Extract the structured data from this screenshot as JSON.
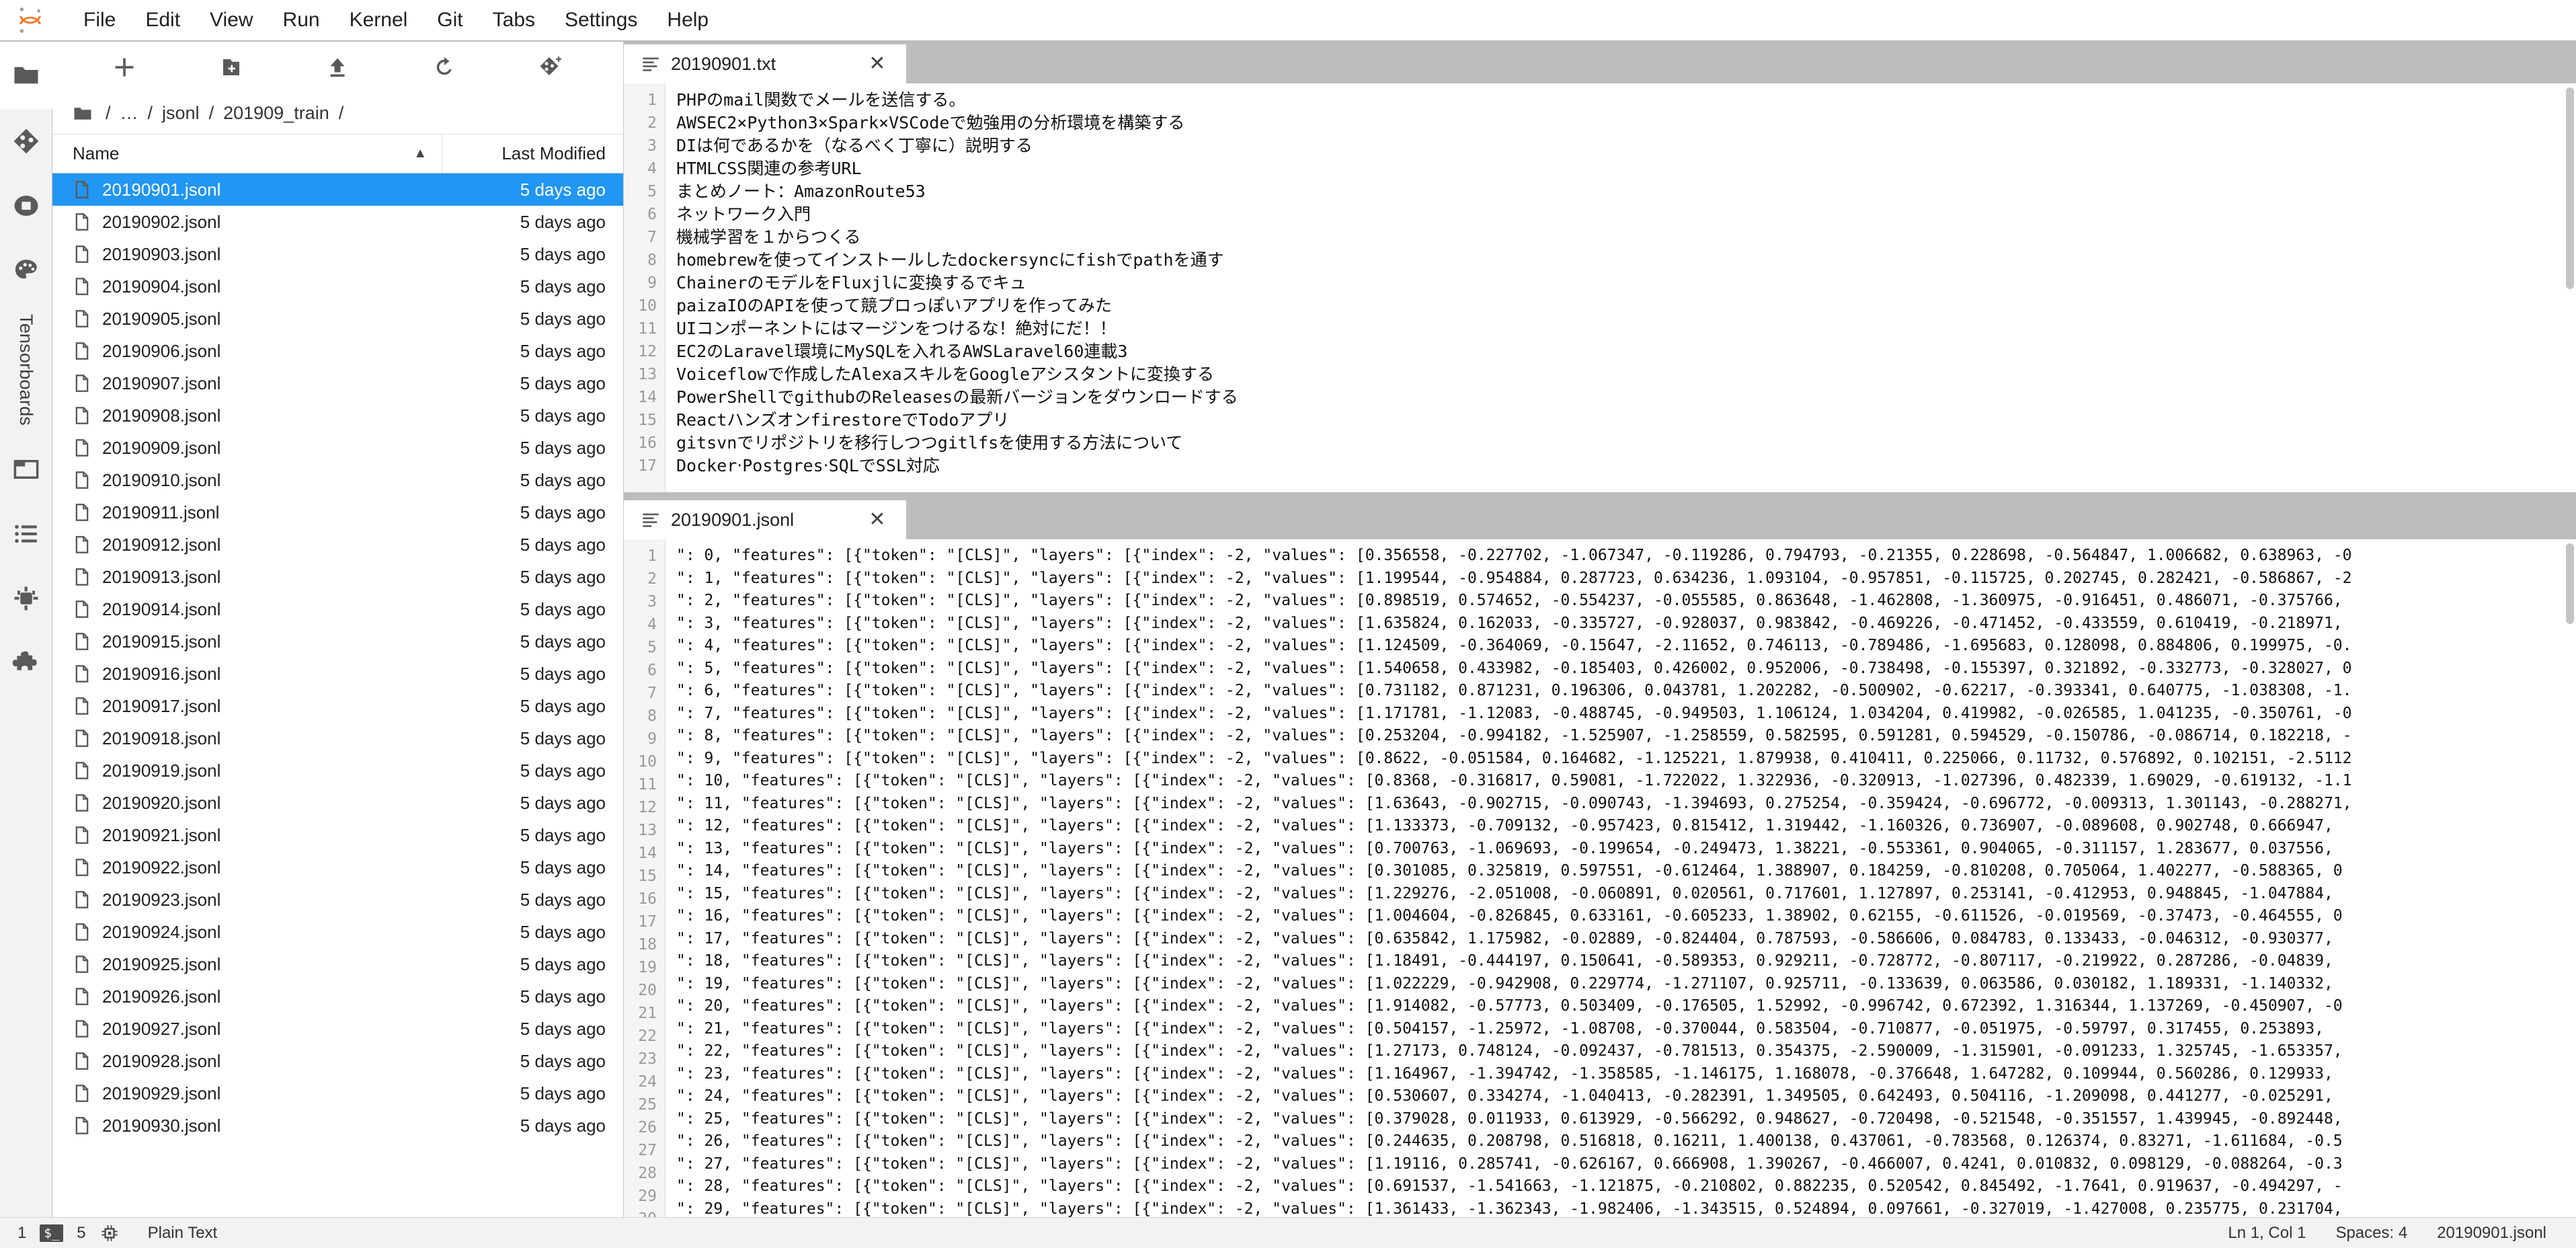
{
  "app": {
    "logo_icon": "jupyter-logo",
    "menu": [
      "File",
      "Edit",
      "View",
      "Run",
      "Kernel",
      "Git",
      "Tabs",
      "Settings",
      "Help"
    ]
  },
  "activitybar": {
    "items": [
      {
        "icon": "folder-icon",
        "name": "file-browser",
        "active": true
      },
      {
        "icon": "git-icon",
        "name": "git",
        "active": false
      },
      {
        "icon": "running-terminals-icon",
        "name": "running",
        "active": false
      },
      {
        "icon": "palette-icon",
        "name": "property-inspector",
        "active": false
      },
      {
        "icon": "tensorboard-label",
        "name": "tensorboards",
        "label": "Tensorboards",
        "active": false
      },
      {
        "icon": "open-tabs-icon",
        "name": "open-tabs",
        "active": false
      },
      {
        "icon": "toc-icon",
        "name": "table-of-contents",
        "active": false
      },
      {
        "icon": "extensions-icon",
        "name": "extension-manager",
        "active": false
      },
      {
        "icon": "puzzle-icon",
        "name": "plugins",
        "active": false
      }
    ]
  },
  "filebrowser": {
    "toolbar": [
      {
        "name": "new-launcher-button",
        "icon": "plus-icon"
      },
      {
        "name": "new-folder-button",
        "icon": "new-folder-icon"
      },
      {
        "name": "upload-button",
        "icon": "upload-icon"
      },
      {
        "name": "refresh-button",
        "icon": "refresh-icon"
      },
      {
        "name": "new-git-clone-button",
        "icon": "git-plus-icon"
      }
    ],
    "breadcrumb": [
      "/",
      "…",
      "/",
      "jsonl",
      "/",
      "201909_train",
      "/"
    ],
    "columns": {
      "name": "Name",
      "modified": "Last Modified"
    },
    "sort_indicator": "▲",
    "files": [
      {
        "name": "20190901.jsonl",
        "modified": "5 days ago",
        "selected": true
      },
      {
        "name": "20190902.jsonl",
        "modified": "5 days ago",
        "selected": false
      },
      {
        "name": "20190903.jsonl",
        "modified": "5 days ago",
        "selected": false
      },
      {
        "name": "20190904.jsonl",
        "modified": "5 days ago",
        "selected": false
      },
      {
        "name": "20190905.jsonl",
        "modified": "5 days ago",
        "selected": false
      },
      {
        "name": "20190906.jsonl",
        "modified": "5 days ago",
        "selected": false
      },
      {
        "name": "20190907.jsonl",
        "modified": "5 days ago",
        "selected": false
      },
      {
        "name": "20190908.jsonl",
        "modified": "5 days ago",
        "selected": false
      },
      {
        "name": "20190909.jsonl",
        "modified": "5 days ago",
        "selected": false
      },
      {
        "name": "20190910.jsonl",
        "modified": "5 days ago",
        "selected": false
      },
      {
        "name": "20190911.jsonl",
        "modified": "5 days ago",
        "selected": false
      },
      {
        "name": "20190912.jsonl",
        "modified": "5 days ago",
        "selected": false
      },
      {
        "name": "20190913.jsonl",
        "modified": "5 days ago",
        "selected": false
      },
      {
        "name": "20190914.jsonl",
        "modified": "5 days ago",
        "selected": false
      },
      {
        "name": "20190915.jsonl",
        "modified": "5 days ago",
        "selected": false
      },
      {
        "name": "20190916.jsonl",
        "modified": "5 days ago",
        "selected": false
      },
      {
        "name": "20190917.jsonl",
        "modified": "5 days ago",
        "selected": false
      },
      {
        "name": "20190918.jsonl",
        "modified": "5 days ago",
        "selected": false
      },
      {
        "name": "20190919.jsonl",
        "modified": "5 days ago",
        "selected": false
      },
      {
        "name": "20190920.jsonl",
        "modified": "5 days ago",
        "selected": false
      },
      {
        "name": "20190921.jsonl",
        "modified": "5 days ago",
        "selected": false
      },
      {
        "name": "20190922.jsonl",
        "modified": "5 days ago",
        "selected": false
      },
      {
        "name": "20190923.jsonl",
        "modified": "5 days ago",
        "selected": false
      },
      {
        "name": "20190924.jsonl",
        "modified": "5 days ago",
        "selected": false
      },
      {
        "name": "20190925.jsonl",
        "modified": "5 days ago",
        "selected": false
      },
      {
        "name": "20190926.jsonl",
        "modified": "5 days ago",
        "selected": false
      },
      {
        "name": "20190927.jsonl",
        "modified": "5 days ago",
        "selected": false
      },
      {
        "name": "20190928.jsonl",
        "modified": "5 days ago",
        "selected": false
      },
      {
        "name": "20190929.jsonl",
        "modified": "5 days ago",
        "selected": false
      },
      {
        "name": "20190930.jsonl",
        "modified": "5 days ago",
        "selected": false
      }
    ]
  },
  "editor_top": {
    "tab_title": "20190901.txt",
    "tab_icon": "text-file-icon",
    "close_icon": "close-icon",
    "lines": [
      "PHPのmail関数でメールを送信する。",
      "AWSEC2×Python3×Spark×VSCodeで勉強用の分析環境を構築する",
      "DIは何であるかを（なるべく丁寧に）説明する",
      "HTMLCSS関連の参考URL",
      "まとめノート：AmazonRoute53",
      "ネットワーク入門",
      "機械学習を１からつくる",
      "homebrewを使ってインストールしたdockersyncにfishでpathを通す",
      "ChainerのモデルをFluxjlに変換するでキュ",
      "paizaIOのAPIを使って競プロっぽいアプリを作ってみた",
      "UIコンポーネントにはマージンをつけるな！絶対にだ！！",
      "EC2のLaravel環境にMySQLを入れるAWSLaravel60連載3",
      "Voiceflowで作成したAlexaスキルをGoogleアシスタントに変換する",
      "PowerShellでgithubのReleasesの最新バージョンをダウンロードする",
      "ReactハンズオンfirestoreでTodoアプリ",
      "gitsvnでリポジトリを移行しつつgitlfsを使用する方法について",
      "Docker‧Postgres‧SQLでSSL対応"
    ]
  },
  "editor_bottom": {
    "tab_title": "20190901.jsonl",
    "tab_icon": "text-file-icon",
    "close_icon": "close-icon",
    "lines": [
      "\": 0, \"features\": [{\"token\": \"[CLS]\", \"layers\": [{\"index\": -2, \"values\": [0.356558, -0.227702, -1.067347, -0.119286, 0.794793, -0.21355, 0.228698, -0.564847, 1.006682, 0.638963, -0",
      "\": 1, \"features\": [{\"token\": \"[CLS]\", \"layers\": [{\"index\": -2, \"values\": [1.199544, -0.954884, 0.287723, 0.634236, 1.093104, -0.957851, -0.115725, 0.202745, 0.282421, -0.586867, -2",
      "\": 2, \"features\": [{\"token\": \"[CLS]\", \"layers\": [{\"index\": -2, \"values\": [0.898519, 0.574652, -0.554237, -0.055585, 0.863648, -1.462808, -1.360975, -0.916451, 0.486071, -0.375766, ",
      "\": 3, \"features\": [{\"token\": \"[CLS]\", \"layers\": [{\"index\": -2, \"values\": [1.635824, 0.162033, -0.335727, -0.928037, 0.983842, -0.469226, -0.471452, -0.433559, 0.610419, -0.218971, ",
      "\": 4, \"features\": [{\"token\": \"[CLS]\", \"layers\": [{\"index\": -2, \"values\": [1.124509, -0.364069, -0.15647, -2.11652, 0.746113, -0.789486, -1.695683, 0.128098, 0.884806, 0.199975, -0.",
      "\": 5, \"features\": [{\"token\": \"[CLS]\", \"layers\": [{\"index\": -2, \"values\": [1.540658, 0.433982, -0.185403, 0.426002, 0.952006, -0.738498, -0.155397, 0.321892, -0.332773, -0.328027, 0",
      "\": 6, \"features\": [{\"token\": \"[CLS]\", \"layers\": [{\"index\": -2, \"values\": [0.731182, 0.871231, 0.196306, 0.043781, 1.202282, -0.500902, -0.62217, -0.393341, 0.640775, -1.038308, -1.",
      "\": 7, \"features\": [{\"token\": \"[CLS]\", \"layers\": [{\"index\": -2, \"values\": [1.171781, -1.12083, -0.488745, -0.949503, 1.106124, 1.034204, 0.419982, -0.026585, 1.041235, -0.350761, -0",
      "\": 8, \"features\": [{\"token\": \"[CLS]\", \"layers\": [{\"index\": -2, \"values\": [0.253204, -0.994182, -1.525907, -1.258559, 0.582595, 0.591281, 0.594529, -0.150786, -0.086714, 0.182218, -",
      "\": 9, \"features\": [{\"token\": \"[CLS]\", \"layers\": [{\"index\": -2, \"values\": [0.8622, -0.051584, 0.164682, -1.125221, 1.879938, 0.410411, 0.225066, 0.11732, 0.576892, 0.102151, -2.5112",
      "\": 10, \"features\": [{\"token\": \"[CLS]\", \"layers\": [{\"index\": -2, \"values\": [0.8368, -0.316817, 0.59081, -1.722022, 1.322936, -0.320913, -1.027396, 0.482339, 1.69029, -0.619132, -1.1",
      "\": 11, \"features\": [{\"token\": \"[CLS]\", \"layers\": [{\"index\": -2, \"values\": [1.63643, -0.902715, -0.090743, -1.394693, 0.275254, -0.359424, -0.696772, -0.009313, 1.301143, -0.288271,",
      "\": 12, \"features\": [{\"token\": \"[CLS]\", \"layers\": [{\"index\": -2, \"values\": [1.133373, -0.709132, -0.957423, 0.815412, 1.319442, -1.160326, 0.736907, -0.089608, 0.902748, 0.666947, ",
      "\": 13, \"features\": [{\"token\": \"[CLS]\", \"layers\": [{\"index\": -2, \"values\": [0.700763, -1.069693, -0.199654, -0.249473, 1.38221, -0.553361, 0.904065, -0.311157, 1.283677, 0.037556, ",
      "\": 14, \"features\": [{\"token\": \"[CLS]\", \"layers\": [{\"index\": -2, \"values\": [0.301085, 0.325819, 0.597551, -0.612464, 1.388907, 0.184259, -0.810208, 0.705064, 1.402277, -0.588365, 0",
      "\": 15, \"features\": [{\"token\": \"[CLS]\", \"layers\": [{\"index\": -2, \"values\": [1.229276, -2.051008, -0.060891, 0.020561, 0.717601, 1.127897, 0.253141, -0.412953, 0.948845, -1.047884, ",
      "\": 16, \"features\": [{\"token\": \"[CLS]\", \"layers\": [{\"index\": -2, \"values\": [1.004604, -0.826845, 0.633161, -0.605233, 1.38902, 0.62155, -0.611526, -0.019569, -0.37473, -0.464555, 0",
      "\": 17, \"features\": [{\"token\": \"[CLS]\", \"layers\": [{\"index\": -2, \"values\": [0.635842, 1.175982, -0.02889, -0.824404, 0.787593, -0.586606, 0.084783, 0.133433, -0.046312, -0.930377, ",
      "\": 18, \"features\": [{\"token\": \"[CLS]\", \"layers\": [{\"index\": -2, \"values\": [1.18491, -0.444197, 0.150641, -0.589353, 0.929211, -0.728772, -0.807117, -0.219922, 0.287286, -0.04839, ",
      "\": 19, \"features\": [{\"token\": \"[CLS]\", \"layers\": [{\"index\": -2, \"values\": [1.022229, -0.942908, 0.229774, -1.271107, 0.925711, -0.133639, 0.063586, 0.030182, 1.189331, -1.140332, ",
      "\": 20, \"features\": [{\"token\": \"[CLS]\", \"layers\": [{\"index\": -2, \"values\": [1.914082, -0.57773, 0.503409, -0.176505, 1.52992, -0.996742, 0.672392, 1.316344, 1.137269, -0.450907, -0",
      "\": 21, \"features\": [{\"token\": \"[CLS]\", \"layers\": [{\"index\": -2, \"values\": [0.504157, -1.25972, -1.08708, -0.370044, 0.583504, -0.710877, -0.051975, -0.59797, 0.317455, 0.253893, ",
      "\": 22, \"features\": [{\"token\": \"[CLS]\", \"layers\": [{\"index\": -2, \"values\": [1.27173, 0.748124, -0.092437, -0.781513, 0.354375, -2.590009, -1.315901, -0.091233, 1.325745, -1.653357,",
      "\": 23, \"features\": [{\"token\": \"[CLS]\", \"layers\": [{\"index\": -2, \"values\": [1.164967, -1.394742, -1.358585, -1.146175, 1.168078, -0.376648, 1.647282, 0.109944, 0.560286, 0.129933, ",
      "\": 24, \"features\": [{\"token\": \"[CLS]\", \"layers\": [{\"index\": -2, \"values\": [0.530607, 0.334274, -1.040413, -0.282391, 1.349505, 0.642493, 0.504116, -1.209098, 0.441277, -0.025291, ",
      "\": 25, \"features\": [{\"token\": \"[CLS]\", \"layers\": [{\"index\": -2, \"values\": [0.379028, 0.011933, 0.613929, -0.566292, 0.948627, -0.720498, -0.521548, -0.351557, 1.439945, -0.892448,",
      "\": 26, \"features\": [{\"token\": \"[CLS]\", \"layers\": [{\"index\": -2, \"values\": [0.244635, 0.208798, 0.516818, 0.16211, 1.400138, 0.437061, -0.783568, 0.126374, 0.83271, -1.611684, -0.5",
      "\": 27, \"features\": [{\"token\": \"[CLS]\", \"layers\": [{\"index\": -2, \"values\": [1.19116, 0.285741, -0.626167, 0.666908, 1.390267, -0.466007, 0.4241, 0.010832, 0.098129, -0.088264, -0.3",
      "\": 28, \"features\": [{\"token\": \"[CLS]\", \"layers\": [{\"index\": -2, \"values\": [0.691537, -1.541663, -1.121875, -0.210802, 0.882235, 0.520542, 0.845492, -1.7641, 0.919637, -0.494297, -",
      "\": 29, \"features\": [{\"token\": \"[CLS]\", \"layers\": [{\"index\": -2, \"values\": [1.361433, -1.362343, -1.982406, -1.343515, 0.524894, 0.097661, -0.327019, -1.427008, 0.235775, 0.231704,"
    ]
  },
  "statusbar": {
    "terminals_count": "1",
    "terminal_icon": "terminal-icon",
    "kernels_count": "5",
    "kernel_icon": "kernel-chip-icon",
    "mode": "Plain Text",
    "cursor": "Ln 1, Col 1",
    "spaces": "Spaces: 4",
    "filename": "20190901.jsonl"
  }
}
